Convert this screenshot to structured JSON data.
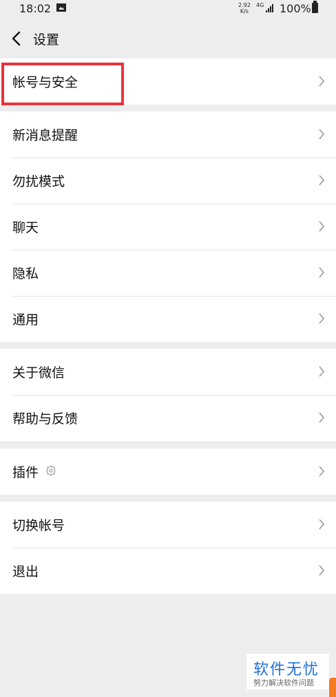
{
  "status_bar": {
    "time": "18:02",
    "speed_value": "2.92",
    "speed_unit": "K/s",
    "network": "4G",
    "battery": "100%"
  },
  "nav": {
    "title": "设置"
  },
  "groups": [
    {
      "items": [
        {
          "label": "帐号与安全"
        }
      ]
    },
    {
      "items": [
        {
          "label": "新消息提醒"
        },
        {
          "label": "勿扰模式"
        },
        {
          "label": "聊天"
        },
        {
          "label": "隐私"
        },
        {
          "label": "通用"
        }
      ]
    },
    {
      "items": [
        {
          "label": "关于微信"
        },
        {
          "label": "帮助与反馈"
        }
      ]
    },
    {
      "items": [
        {
          "label": "插件"
        }
      ]
    },
    {
      "items": [
        {
          "label": "切换帐号"
        },
        {
          "label": "退出"
        }
      ]
    }
  ],
  "watermark": {
    "title": "软件无忧",
    "subtitle": "努力解决软件问题"
  },
  "colors": {
    "background": "#ededed",
    "highlight": "#e8333b",
    "watermark_blue": "#1e6fd6"
  }
}
